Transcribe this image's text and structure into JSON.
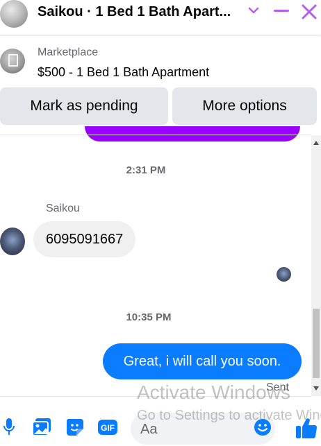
{
  "header": {
    "title": "Saikou · 1 Bed 1 Bath Apart...",
    "accent_color": "#b65cf2",
    "icons": [
      "avatar",
      "chevron-down-icon",
      "minimize-icon",
      "close-icon"
    ]
  },
  "marketplace": {
    "label": "Marketplace",
    "title": "$500 - 1 Bed 1 Bath Apartment"
  },
  "actions": {
    "pending_label": "Mark as pending",
    "more_label": "More options"
  },
  "conversation": {
    "timestamp_1": "2:31 PM",
    "sender_name": "Saikou",
    "incoming_message": "6095091667",
    "timestamp_2": "10:35 PM",
    "outgoing_message": "Great, i will call you soon.",
    "status": "Sent",
    "outgoing_color": "#0a7cff",
    "incoming_color": "#f0f0f0"
  },
  "composer": {
    "placeholder": "Aa",
    "icons": [
      "microphone-icon",
      "image-icon",
      "sticker-icon",
      "gif-icon",
      "emoji-icon",
      "like-icon"
    ],
    "icon_color": "#0a7cff"
  },
  "watermark": {
    "line1": "Activate Windows",
    "line2": "Go to Settings to activate Windows."
  }
}
